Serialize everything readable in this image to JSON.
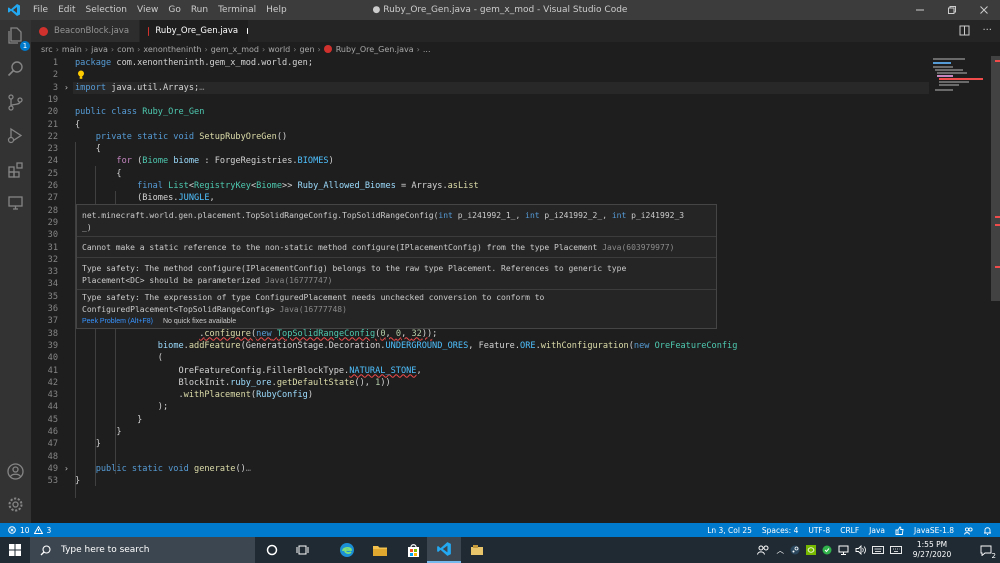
{
  "titlebar": {
    "menus": [
      "File",
      "Edit",
      "Selection",
      "View",
      "Go",
      "Run",
      "Terminal",
      "Help"
    ],
    "window_title": "● Ruby_Ore_Gen.java - gem_x_mod - Visual Studio Code"
  },
  "activity": {
    "source_control_badge": "1"
  },
  "tabs": [
    {
      "label": "BeaconBlock.java",
      "active": false
    },
    {
      "label": "Ruby_Ore_Gen.java",
      "active": true
    }
  ],
  "breadcrumb": [
    "src",
    "main",
    "java",
    "com",
    "xenontheninth",
    "gem_x_mod",
    "world",
    "gen",
    "Ruby_Ore_Gen.java",
    "..."
  ],
  "editor": {
    "lines": [
      {
        "n": "1",
        "html": "<span class=\"k\">package</span> com.xenontheninth.gem_x_mod.world.gen;"
      },
      {
        "n": "2",
        "html": ""
      },
      {
        "n": "3",
        "fold": "›",
        "html": "<span class=\"k\">import</span> java.util.Arrays;<span class=\"d\">…</span>"
      },
      {
        "n": "19",
        "html": ""
      },
      {
        "n": "20",
        "html": "<span class=\"k\">public class</span> <span class=\"t\">Ruby_Ore_Gen</span>"
      },
      {
        "n": "21",
        "html": "{"
      },
      {
        "n": "22",
        "html": "    <span class=\"k\">private static void</span> <span class=\"f\">SetupRubyOreGen</span>()"
      },
      {
        "n": "23",
        "html": "    {"
      },
      {
        "n": "24",
        "html": "        <span class=\"c\">for</span> (<span class=\"t\">Biome</span> <span class=\"v\">biome</span> : ForgeRegistries.<span class=\"const\">BIOMES</span>)"
      },
      {
        "n": "25",
        "html": "        {"
      },
      {
        "n": "26",
        "html": "            <span class=\"k\">final</span> <span class=\"t\">List</span>&lt;<span class=\"t\">RegistryKey</span>&lt;<span class=\"t\">Biome</span>&gt;&gt; <span class=\"v\">Ruby_Allowed_Biomes</span> = Arrays.<span class=\"f\">asList</span>"
      },
      {
        "n": "27",
        "html": "            (Biomes.<span class=\"const\">JUNGLE</span>,"
      },
      {
        "n": "28",
        "html": ""
      },
      {
        "n": "29",
        "html": ""
      },
      {
        "n": "30",
        "html": ""
      },
      {
        "n": "31",
        "html": ""
      },
      {
        "n": "32",
        "html": ""
      },
      {
        "n": "33",
        "html": ""
      },
      {
        "n": "34",
        "html": ""
      },
      {
        "n": "35",
        "html": ""
      },
      {
        "n": "36",
        "html": ""
      },
      {
        "n": "37",
        "html": ""
      },
      {
        "n": "38",
        "html": "                        <span class=\"squig\">.<span class=\"f\">configure</span>(<span class=\"k\">new</span> <span class=\"t\">TopSolidRangeConfig</span>(<span class=\"n\">0</span>, <span class=\"n\">0</span>, <span class=\"n\">32</span>))</span>;"
      },
      {
        "n": "39",
        "html": "                <span class=\"v\">biome</span>.<span class=\"f\">addFeature</span>(GenerationStage.Decoration.<span class=\"const\">UNDERGROUND_ORES</span>, Feature.<span class=\"const\">ORE</span>.<span class=\"f\">withConfiguration</span>(<span class=\"k\">new</span> <span class=\"t\">OreFeatureConfig</span>"
      },
      {
        "n": "40",
        "html": "                ("
      },
      {
        "n": "41",
        "html": "                    OreFeatureConfig.FillerBlockType.<span class=\"squig\"><span class=\"const\">NATURAL_STONE</span></span>,"
      },
      {
        "n": "42",
        "html": "                    BlockInit.<span class=\"v\">ruby_ore</span>.<span class=\"f\">getDefaultState</span>(), <span class=\"n\">1</span>))"
      },
      {
        "n": "43",
        "html": "                    .<span class=\"f\">withPlacement</span>(<span class=\"v\">RubyConfig</span>)"
      },
      {
        "n": "44",
        "html": "                );"
      },
      {
        "n": "45",
        "html": "            }"
      },
      {
        "n": "46",
        "html": "        }"
      },
      {
        "n": "47",
        "html": "    }"
      },
      {
        "n": "48",
        "html": ""
      },
      {
        "n": "49",
        "fold": "›",
        "html": "    <span class=\"k\">public static void</span> <span class=\"f\">generate</span>()<span class=\"d\">…</span>"
      },
      {
        "n": "53",
        "html": "}"
      }
    ]
  },
  "hover": {
    "signature": "net.minecraft.world.gen.placement.TopSolidRangeConfig.TopSolidRangeConfig(int p_i241992_1_, int p_i241992_2_, int p_i241992_3_)",
    "sig_line1": "net.minecraft.world.gen.placement.TopSolidRangeConfig.TopSolidRangeConfig(",
    "sig_int1": "int",
    "sig_p1": " p_i241992_1_, ",
    "sig_int2": "int",
    "sig_p2": " p_i241992_2_, ",
    "sig_int3": "int",
    "sig_p3": " p_i241992_3",
    "sig_line2": "_)",
    "problem1_text": "Cannot make a static reference to the non-static method configure(IPlacementConfig) from the type Placement",
    "problem1_code": "Java(603979977)",
    "problem2_line1": "Type safety: The method configure(IPlacementConfig) belongs to the raw type Placement. References to generic type",
    "problem2_line2": "Placement<DC> should be parameterized",
    "problem2_code": "Java(16777747)",
    "problem3_line1": "Type safety: The expression of type ConfiguredPlacement needs unchecked conversion to conform to",
    "problem3_line2": "ConfiguredPlacement<TopSolidRangeConfig>",
    "problem3_code": "Java(16777748)",
    "peek_label": "Peek Problem (Alt+F8)",
    "no_fix_label": "No quick fixes available"
  },
  "statusbar": {
    "errors": "10",
    "warnings": "3",
    "cursor": "Ln 3, Col 25",
    "spaces": "Spaces: 4",
    "encoding": "UTF-8",
    "eol": "CRLF",
    "language": "Java",
    "jdk": "JavaSE-1.8"
  },
  "taskbar": {
    "search_placeholder": "Type here to search",
    "time": "1:55 PM",
    "date": "9/27/2020",
    "notification_count": "2"
  }
}
